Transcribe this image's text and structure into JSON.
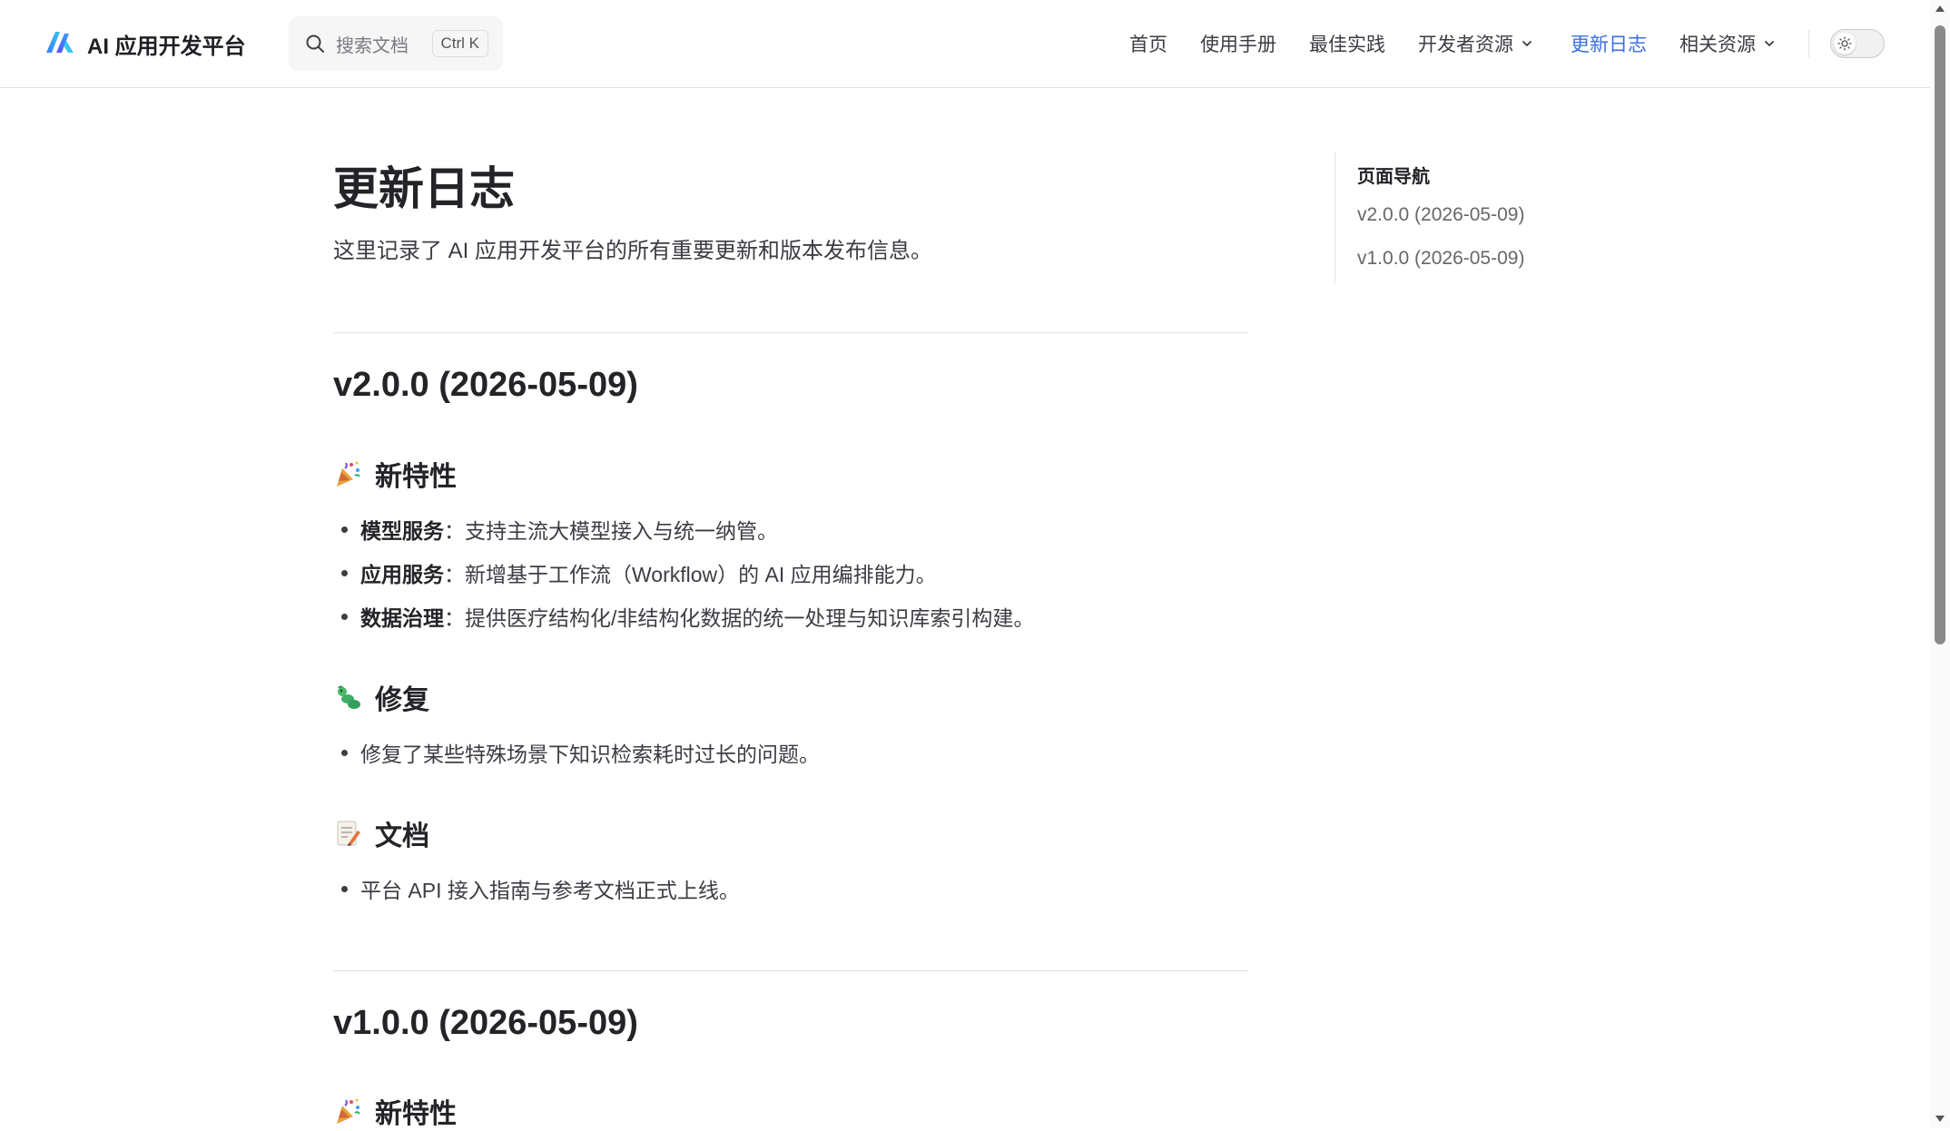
{
  "brand": {
    "title": "AI 应用开发平台",
    "icon": "logo-icon"
  },
  "search": {
    "placeholder": "搜索文档",
    "shortcut": "Ctrl K",
    "icon": "search-icon"
  },
  "nav": {
    "items": [
      {
        "label": "首页"
      },
      {
        "label": "使用手册"
      },
      {
        "label": "最佳实践"
      },
      {
        "label": "开发者资源",
        "dropdown": true
      },
      {
        "label": "更新日志",
        "active": true
      },
      {
        "label": "相关资源",
        "dropdown": true
      }
    ],
    "active_color": "#3a6fe0",
    "theme_toggle_icon": "sun-icon"
  },
  "page": {
    "title": "更新日志",
    "lead": "这里记录了 AI 应用开发平台的所有重要更新和版本发布信息。"
  },
  "releases": [
    {
      "heading": "v2.0.0 (2026-05-09)",
      "sections": [
        {
          "title": "新特性",
          "icon": "party-popper-icon",
          "items": [
            {
              "label": "模型服务",
              "text": "：支持主流大模型接入与统一纳管。"
            },
            {
              "label": "应用服务",
              "text": "：新增基于工作流（Workflow）的 AI 应用编排能力。"
            },
            {
              "label": "数据治理",
              "text": "：提供医疗结构化/非结构化数据的统一处理与知识库索引构建。"
            }
          ]
        },
        {
          "title": "修复",
          "icon": "bug-icon",
          "items": [
            {
              "text": "修复了某些特殊场景下知识检索耗时过长的问题。"
            }
          ]
        },
        {
          "title": "文档",
          "icon": "memo-icon",
          "items": [
            {
              "text": "平台 API 接入指南与参考文档正式上线。"
            }
          ]
        }
      ]
    },
    {
      "heading": "v1.0.0 (2026-05-09)",
      "sections": [
        {
          "title": "新特性",
          "icon": "party-popper-icon"
        }
      ]
    }
  ],
  "toc": {
    "title": "页面导航",
    "items": [
      "v2.0.0 (2026-05-09)",
      "v1.0.0 (2026-05-09)"
    ]
  }
}
